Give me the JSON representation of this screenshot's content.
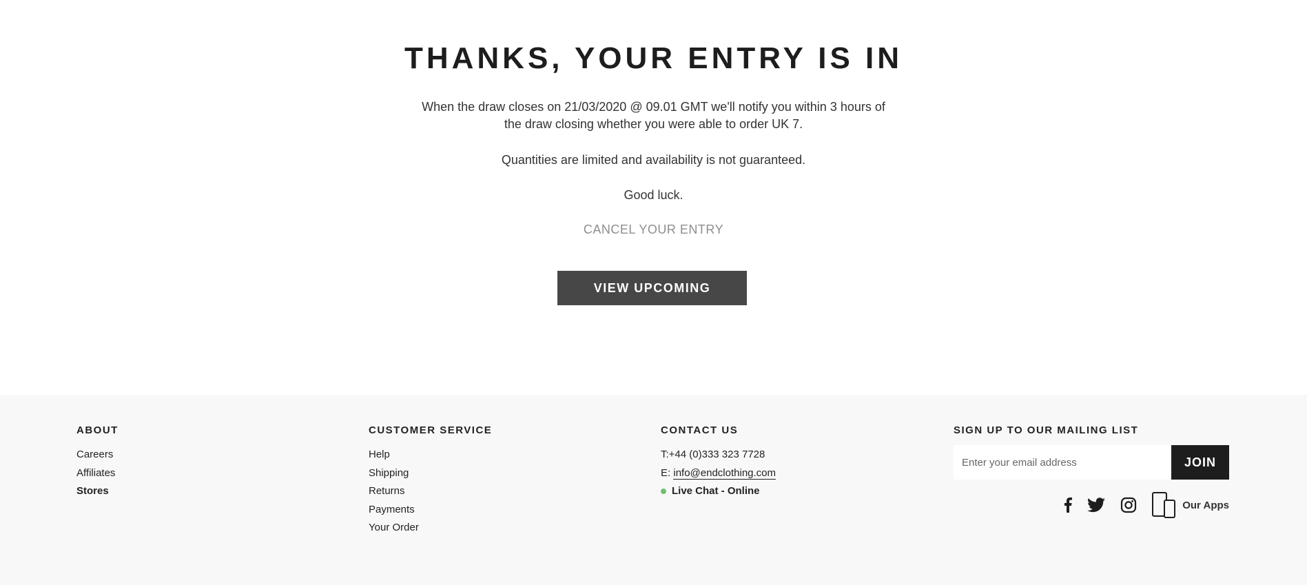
{
  "confirmation": {
    "title": "THANKS, YOUR ENTRY IS IN",
    "message_1": "When the draw closes on 21/03/2020 @ 09.01 GMT we'll notify you within 3 hours of the draw closing whether you were able to order UK 7.",
    "message_2": "Quantities are limited and availability is not guaranteed.",
    "message_3": "Good luck.",
    "cancel_label": "CANCEL YOUR ENTRY",
    "view_upcoming_label": "VIEW UPCOMING"
  },
  "footer": {
    "about": {
      "heading": "ABOUT",
      "links": [
        "Careers",
        "Affiliates",
        "Stores"
      ]
    },
    "customer_service": {
      "heading": "CUSTOMER SERVICE",
      "links": [
        "Help",
        "Shipping",
        "Returns",
        "Payments",
        "Your Order"
      ]
    },
    "contact": {
      "heading": "CONTACT US",
      "phone": "T:+44 (0)333 323 7728",
      "email_prefix": "E:",
      "email": "info@endclothing.com",
      "live_chat": "Live Chat - Online",
      "live_status_color": "#6fbf73"
    },
    "mailing": {
      "heading": "SIGN UP TO OUR MAILING LIST",
      "placeholder": "Enter your email address",
      "join_label": "JOIN"
    },
    "social": {
      "icons": [
        "facebook-icon",
        "twitter-icon",
        "instagram-icon",
        "devices-icon"
      ],
      "apps_label": "Our Apps"
    }
  },
  "colors": {
    "button_dark": "#474747",
    "join_dark": "#1d1d1d",
    "footer_bg": "#f8f8f8",
    "cancel_text": "#8e8e8e"
  }
}
